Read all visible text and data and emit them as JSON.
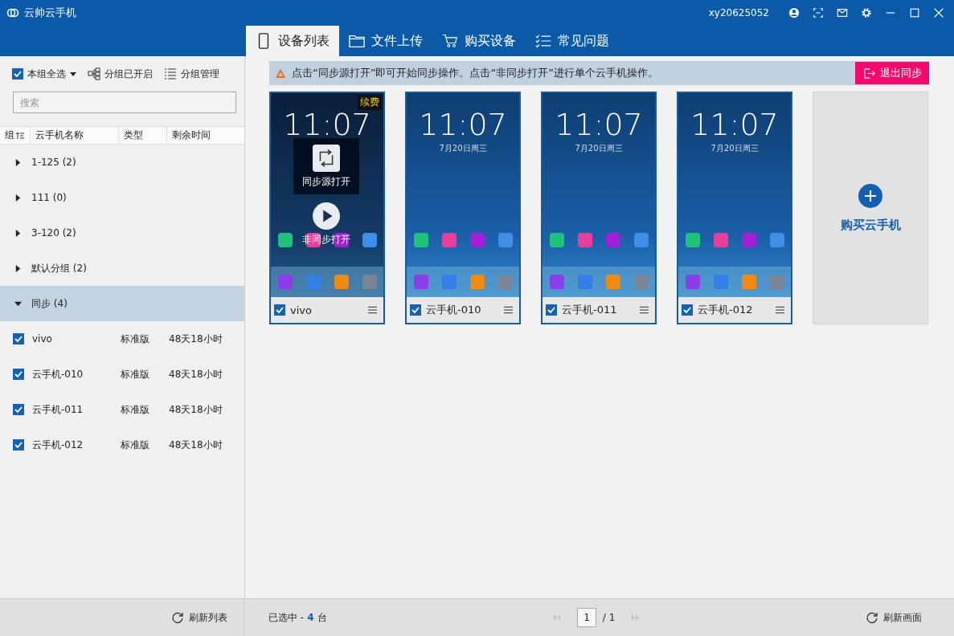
{
  "window": {
    "title": "云帅云手机",
    "username": "xy20625052"
  },
  "tabs": [
    {
      "label": "设备列表",
      "kind": "phone",
      "selected": true
    },
    {
      "label": "文件上传",
      "kind": "folder",
      "selected": false
    },
    {
      "label": "购买设备",
      "kind": "cart",
      "selected": false
    },
    {
      "label": "常见问题",
      "kind": "faq",
      "selected": false
    }
  ],
  "sidebar": {
    "select_all": {
      "label": "本组全选",
      "checked": true
    },
    "group_toggle": "分组已开启",
    "group_manage": "分组管理",
    "search": {
      "placeholder": "搜索"
    },
    "columns": [
      "组",
      "云手机名称",
      "类型",
      "剩余时间"
    ],
    "groups": [
      {
        "label": "1-125 (2)",
        "expanded": false,
        "selected": false
      },
      {
        "label": "111 (0)",
        "expanded": false,
        "selected": false
      },
      {
        "label": "3-120 (2)",
        "expanded": false,
        "selected": false
      },
      {
        "label": "默认分组 (2)",
        "expanded": false,
        "selected": false
      },
      {
        "label": "同步 (4)",
        "expanded": true,
        "selected": true,
        "children": [
          {
            "name": "vivo",
            "type": "标准版",
            "remaining": "48天18小时",
            "checked": true
          },
          {
            "name": "云手机-010",
            "type": "标准版",
            "remaining": "48天18小时",
            "checked": true
          },
          {
            "name": "云手机-011",
            "type": "标准版",
            "remaining": "48天18小时",
            "checked": true
          },
          {
            "name": "云手机-012",
            "type": "标准版",
            "remaining": "48天18小时",
            "checked": true
          }
        ]
      }
    ]
  },
  "notice": {
    "text": "点击“同步源打开”即可开始同步操作。点击“非同步打开”进行单个云手机操作。",
    "button": "退出同步"
  },
  "devices": [
    {
      "name": "vivo",
      "checked": true,
      "clock": "11:07",
      "badge": "续费",
      "overlay": {
        "sync": "同步源打开",
        "async": "非同步打开"
      }
    },
    {
      "name": "云手机-010",
      "checked": true,
      "clock": "11:07",
      "date": "7月20日周三"
    },
    {
      "name": "云手机-011",
      "checked": true,
      "clock": "11:07",
      "date": "7月20日周三"
    },
    {
      "name": "云手机-012",
      "checked": true,
      "clock": "11:07",
      "date": "7月20日周三"
    }
  ],
  "buy_card": "购买云手机",
  "footer": {
    "refresh_list": "刷新列表",
    "selected_label": "已选中 -",
    "selected_count": "4",
    "selected_unit": "台",
    "page": "1",
    "page_total": "/ 1",
    "refresh_screen": "刷新画面"
  }
}
